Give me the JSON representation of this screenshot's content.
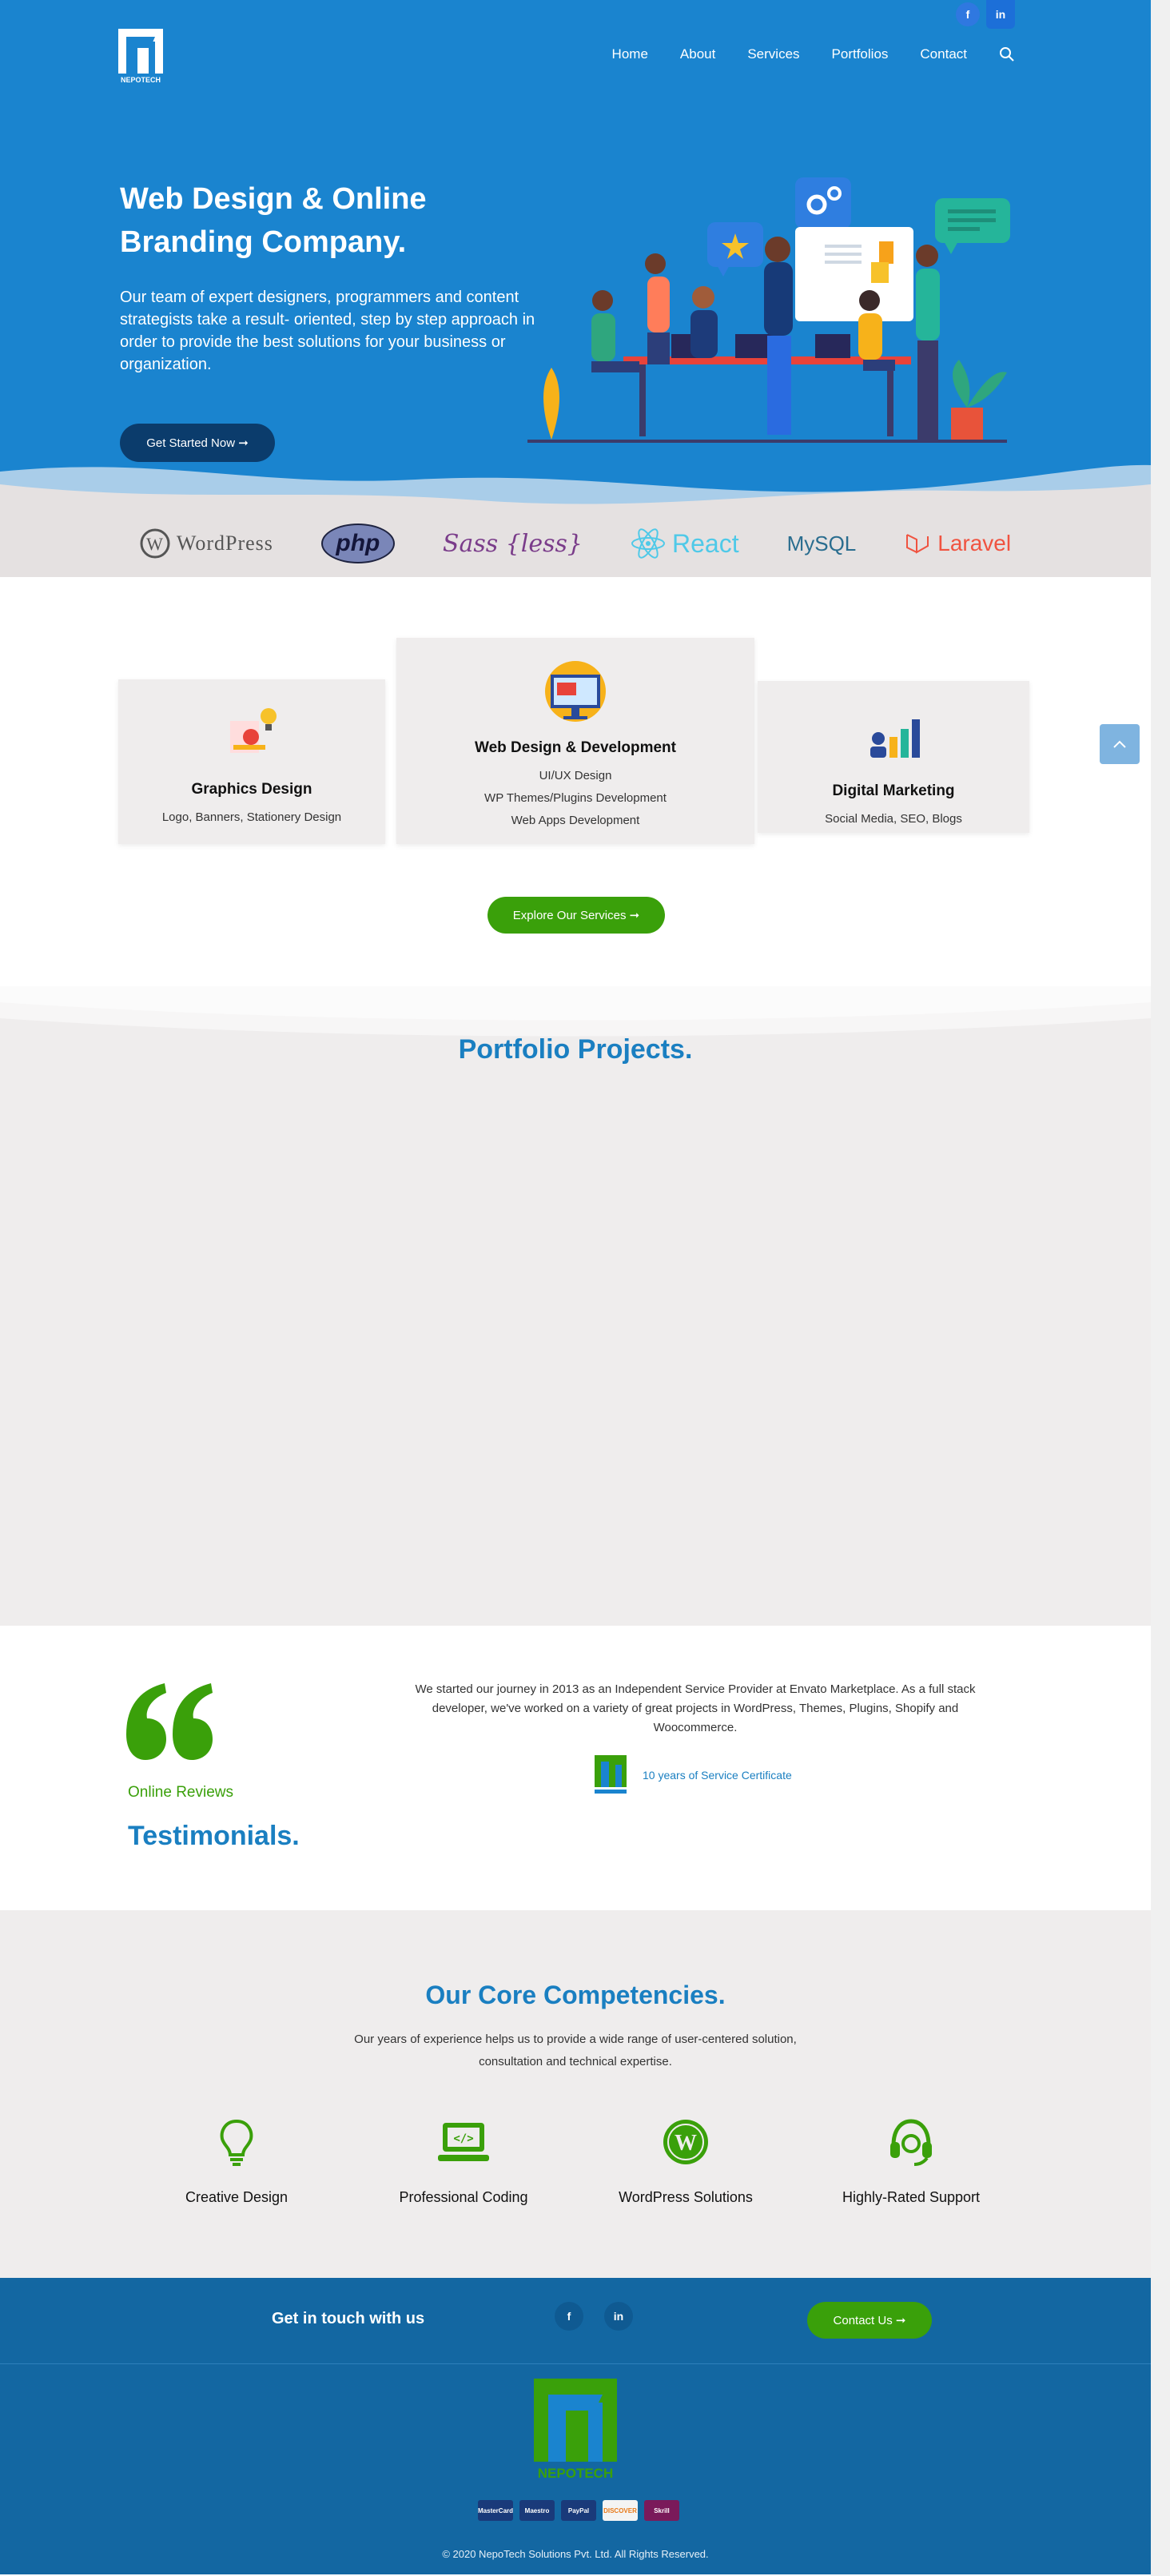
{
  "header": {
    "social": {
      "facebook_glyph": "f",
      "linkedin_glyph": "in"
    },
    "logo_text": "NEPOTECH",
    "nav": [
      "Home",
      "About",
      "Services",
      "Portfolios",
      "Contact"
    ],
    "search_icon": "search-icon"
  },
  "hero": {
    "title": "Web Design & Online Branding Company.",
    "lead": "Our team of expert designers, programmers and content strategists take a result- oriented, step by step approach in order to provide the best solutions for your business or organization.",
    "cta": "Get Started Now ➞"
  },
  "tech_logos": [
    "WordPress",
    "php",
    "Sass {less}",
    "React",
    "MySQL",
    "Laravel"
  ],
  "services": [
    {
      "title": "Graphics Design",
      "lines": [
        "Logo, Banners, Stationery Design"
      ]
    },
    {
      "title": "Web Design & Development",
      "lines": [
        "UI/UX Design",
        "WP Themes/Plugins Development",
        "Web Apps Development"
      ]
    },
    {
      "title": "Digital Marketing",
      "lines": [
        "Social Media, SEO, Blogs"
      ]
    }
  ],
  "explore_button": "Explore Our Services ➞",
  "portfolio": {
    "title": "Portfolio Projects."
  },
  "testimonials": {
    "label": "Online Reviews",
    "title": "Testimonials.",
    "text": "We started our journey in 2013 as an Independent Service Provider at Envato Marketplace. As a full stack developer, we've worked on a variety of great projects in WordPress, Themes, Plugins, Shopify and Woocommerce.",
    "certificate": "10 years of Service Certificate"
  },
  "competencies": {
    "title": "Our Core Competencies.",
    "subtitle": "Our years of experience helps us to provide a wide range of user-centered solution, consultation and technical expertise.",
    "items": [
      "Creative Design",
      "Professional Coding",
      "WordPress Solutions",
      "Highly-Rated Support"
    ]
  },
  "touch": {
    "label": "Get in touch with us",
    "contact_button": "Contact Us ➞"
  },
  "footer": {
    "payments": [
      "MasterCard",
      "Maestro",
      "PayPal",
      "DISCOVER",
      "Skrill"
    ],
    "copyright": "© 2020 NepoTech Solutions Pvt. Ltd. All Rights Reserved."
  },
  "colors": {
    "primary_blue": "#1a84cf",
    "accent_green": "#3aa00a",
    "heading_blue": "#1a7fc1",
    "dark_navy": "#0b3c6c"
  }
}
